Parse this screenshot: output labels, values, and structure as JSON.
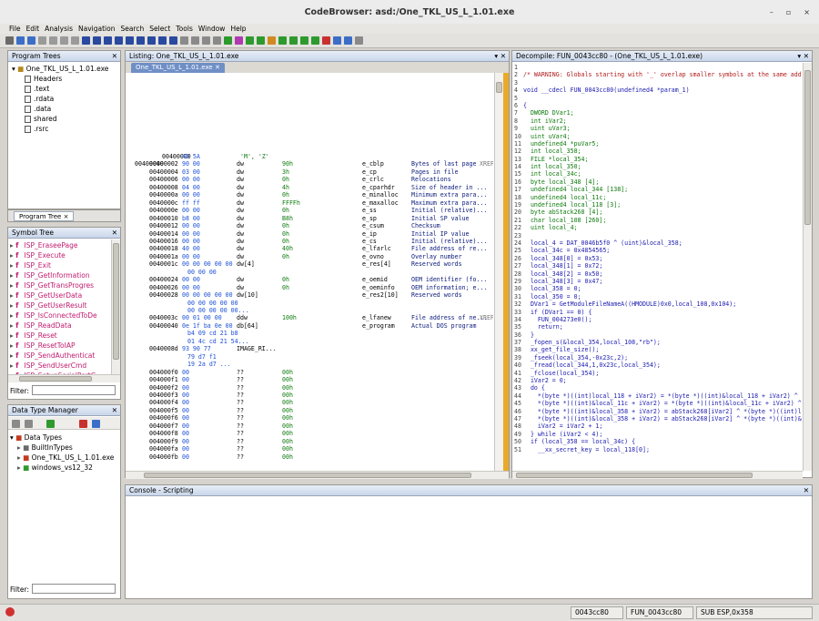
{
  "window": {
    "title": "CodeBrowser: asd:/One_TKL_US_L_1.01.exe",
    "minimize": "–",
    "maximize": "▫",
    "close": "×"
  },
  "menu": [
    "File",
    "Edit",
    "Analysis",
    "Navigation",
    "Search",
    "Select",
    "Tools",
    "Window",
    "Help"
  ],
  "program_trees": {
    "header": "Program Trees",
    "root": "One_TKL_US_L_1.01.exe",
    "items": [
      "Headers",
      ".text",
      ".rdata",
      ".data",
      "shared",
      ".rsrc"
    ],
    "tab": "Program Tree ×"
  },
  "symbol_tree": {
    "header": "Symbol Tree",
    "items": [
      "ISP_EraseePage",
      "ISP_Execute",
      "ISP_Exit",
      "ISP_GetInformation",
      "ISP_GetTransProgres",
      "ISP_GetUserData",
      "ISP_GetUserResult",
      "ISP_IsConnectedToDe",
      "ISP_ReadData",
      "ISP_Reset",
      "ISP_ResetToIAP",
      "ISP_SendAuthenticat",
      "ISP_SendUserCmd",
      "ISP_SetupSerialPortC"
    ],
    "filter_label": "Filter:"
  },
  "data_types": {
    "header": "Data Type Manager",
    "root": "Data Types",
    "items": [
      "BuiltInTypes",
      "One_TKL_US_L_1.01.exe",
      "windows_vs12_32"
    ],
    "filter_label": "Filter:"
  },
  "listing": {
    "header": "Listing:  One_TKL_US_L_1.01.exe",
    "tab": "One_TKL_US_L_1.01.exe",
    "lines": [
      [
        "",
        "00400000 ",
        "4D 5A",
        "",
        "'M', 'Z'",
        "",
        "",
        ""
      ],
      [
        "00400000",
        "00400002 ",
        "90 00",
        "dw",
        "90h",
        "e_cblp",
        "Bytes of last page",
        "XREF"
      ],
      [
        "",
        "00400004 ",
        "03 00",
        "dw",
        "3h",
        "e_cp",
        "Pages in file",
        ""
      ],
      [
        "",
        "00400006 ",
        "00 00",
        "dw",
        "0h",
        "e_crlc",
        "Relocations",
        ""
      ],
      [
        "",
        "00400008 ",
        "04 00",
        "dw",
        "4h",
        "e_cparhdr",
        "Size of header in ...",
        ""
      ],
      [
        "",
        "0040000a ",
        "00 00",
        "dw",
        "0h",
        "e_minalloc",
        "Minimum extra para...",
        ""
      ],
      [
        "",
        "0040000c ",
        "ff ff",
        "dw",
        "FFFFh",
        "e_maxalloc",
        "Maximum extra para...",
        ""
      ],
      [
        "",
        "0040000e ",
        "00 00",
        "dw",
        "0h",
        "e_ss",
        "Initial (relative)...",
        ""
      ],
      [
        "",
        "00400010 ",
        "b8 00",
        "dw",
        "B8h",
        "e_sp",
        "Initial SP value",
        ""
      ],
      [
        "",
        "00400012 ",
        "00 00",
        "dw",
        "0h",
        "e_csum",
        "Checksum",
        ""
      ],
      [
        "",
        "00400014 ",
        "00 00",
        "dw",
        "0h",
        "e_ip",
        "Initial IP value",
        ""
      ],
      [
        "",
        "00400016 ",
        "00 00",
        "dw",
        "0h",
        "e_cs",
        "Initial (relative)...",
        ""
      ],
      [
        "",
        "00400018 ",
        "40 00",
        "dw",
        "40h",
        "e_lfarlc",
        "File address of re...",
        ""
      ],
      [
        "",
        "0040001a ",
        "00 00",
        "dw",
        "0h",
        "e_ovno",
        "Overlay number",
        ""
      ],
      [
        "",
        "0040001c ",
        "00 00 00 00 00",
        "dw[4]",
        "",
        "e_res[4]",
        "Reserved words",
        ""
      ],
      [
        "",
        "",
        "00 00 00",
        "",
        "",
        "",
        "",
        ""
      ],
      [
        "",
        "00400024 ",
        "00 00",
        "dw",
        "0h",
        "e_oemid",
        "OEM identifier (fo...",
        ""
      ],
      [
        "",
        "00400026 ",
        "00 00",
        "dw",
        "0h",
        "e_oeminfo",
        "OEM information; e...",
        ""
      ],
      [
        "",
        "00400028 ",
        "00 00 00 00 00",
        "dw[10]",
        "",
        "e_res2[10]",
        "Reserved words",
        ""
      ],
      [
        "",
        "",
        "00 00 00 00 00",
        "",
        "",
        "",
        "",
        ""
      ],
      [
        "",
        "",
        "00 00 00 00 00...",
        "",
        "",
        "",
        "",
        ""
      ],
      [
        "",
        "0040003c ",
        "00 01 00 00",
        "ddw",
        "100h",
        "e_lfanew",
        "File address of ne...",
        "XREF"
      ],
      [
        "",
        "00400040 ",
        "0e 1f ba 0e 00",
        "db[64]",
        "",
        "e_program",
        "Actual DOS program",
        ""
      ],
      [
        "",
        "",
        "b4 09 cd 21 b8",
        "",
        "",
        "",
        "",
        ""
      ],
      [
        "",
        "",
        "01 4c cd 21 54...",
        "",
        "",
        "",
        "",
        ""
      ],
      [
        "",
        "0040008d ",
        "93 90 77",
        "IMAGE_RI...",
        "",
        "",
        "",
        ""
      ],
      [
        "",
        "",
        "79 d7 f1",
        "",
        "",
        "",
        "",
        ""
      ],
      [
        "",
        "",
        "19 2a d7 ...",
        "",
        "",
        "",
        "",
        ""
      ],
      [
        "",
        "004000f0 ",
        "00",
        "??",
        "00h",
        "",
        "",
        ""
      ],
      [
        "",
        "004000f1 ",
        "00",
        "??",
        "00h",
        "",
        "",
        ""
      ],
      [
        "",
        "004000f2 ",
        "00",
        "??",
        "00h",
        "",
        "",
        ""
      ],
      [
        "",
        "004000f3 ",
        "00",
        "??",
        "00h",
        "",
        "",
        ""
      ],
      [
        "",
        "004000f4 ",
        "00",
        "??",
        "00h",
        "",
        "",
        ""
      ],
      [
        "",
        "004000f5 ",
        "00",
        "??",
        "00h",
        "",
        "",
        ""
      ],
      [
        "",
        "004000f6 ",
        "00",
        "??",
        "00h",
        "",
        "",
        ""
      ],
      [
        "",
        "004000f7 ",
        "00",
        "??",
        "00h",
        "",
        "",
        ""
      ],
      [
        "",
        "004000f8 ",
        "00",
        "??",
        "00h",
        "",
        "",
        ""
      ],
      [
        "",
        "004000f9 ",
        "00",
        "??",
        "00h",
        "",
        "",
        ""
      ],
      [
        "",
        "004000fa ",
        "00",
        "??",
        "00h",
        "",
        "",
        ""
      ],
      [
        "",
        "004000fb ",
        "00",
        "??",
        "00h",
        "",
        "",
        ""
      ]
    ]
  },
  "decompile": {
    "header": "Decompile: FUN_0043cc80 - (One_TKL_US_L_1.01.exe)",
    "lines": [
      "",
      "/* WARNING: Globals starting with '_' overlap smaller symbols at the same addres",
      "",
      "void __cdecl FUN_0043cc80(undefined4 *param_1)",
      "",
      "{",
      "  DWORD DVar1;",
      "  int iVar2;",
      "  uint uVar3;",
      "  uint uVar4;",
      "  undefined4 *puVar5;",
      "  int local_358;",
      "  FILE *local_354;",
      "  int local_350;",
      "  int local_34c;",
      "  byte local_348 [4];",
      "  undefined4 local_344 [138];",
      "  undefined4 local_11c;",
      "  undefined4 local_118 [3];",
      "  byte abStack268 [4];",
      "  char local_108 [260];",
      "  uint local_4;",
      "",
      "  local_4 = DAT_0046b5f0 ^ (uint)&local_358;",
      "  local_34c = 0x4854565;",
      "  local_348[0] = 0x53;",
      "  local_348[1] = 0x72;",
      "  local_348[2] = 0x50;",
      "  local_348[3] = 0x47;",
      "  local_358 = 0;",
      "  local_350 = 0;",
      "  DVar1 = GetModuleFileNameA((HMODULE)0x0,local_108,0x104);",
      "  if (DVar1 == 0) {",
      "    FUN_004273e0();",
      "    return;",
      "  }",
      "  _fopen_s(&local_354,local_108,\"rb\");",
      "  xx_get_file_size();",
      "  _fseek(local_354,-0x23c,2);",
      "  _fread(local_344,1,0x23c,local_354);",
      "  _fclose(local_354);",
      "  iVar2 = 0;",
      "  do {",
      "    *(byte *)((int)local_118 + iVar2) = *(byte *)((int)&local_118 + iVar2) ^ loca",
      "    *(byte *)((int)&local_11c + iVar2) = *(byte *)((int)&local_11c + iVar2) ^ lo",
      "    *(byte *)((int)&local_358 + iVar2) = abStack268[iVar2] ^ *(byte *)((int)loca",
      "    *(byte *)((int)&local_358 + iVar2) = abStack268[iVar2] ^ *(byte *)((int)&lo",
      "    iVar2 = iVar2 + 1;",
      "  } while (iVar2 < 4);",
      "  if (local_358 == local_34c) {",
      "    __xx_secret_key = local_118[0];"
    ]
  },
  "console": {
    "header": "Console - Scripting"
  },
  "status": {
    "addr": "0043cc80",
    "func": "FUN_0043cc80",
    "instr": "SUB ESP,0x358"
  }
}
